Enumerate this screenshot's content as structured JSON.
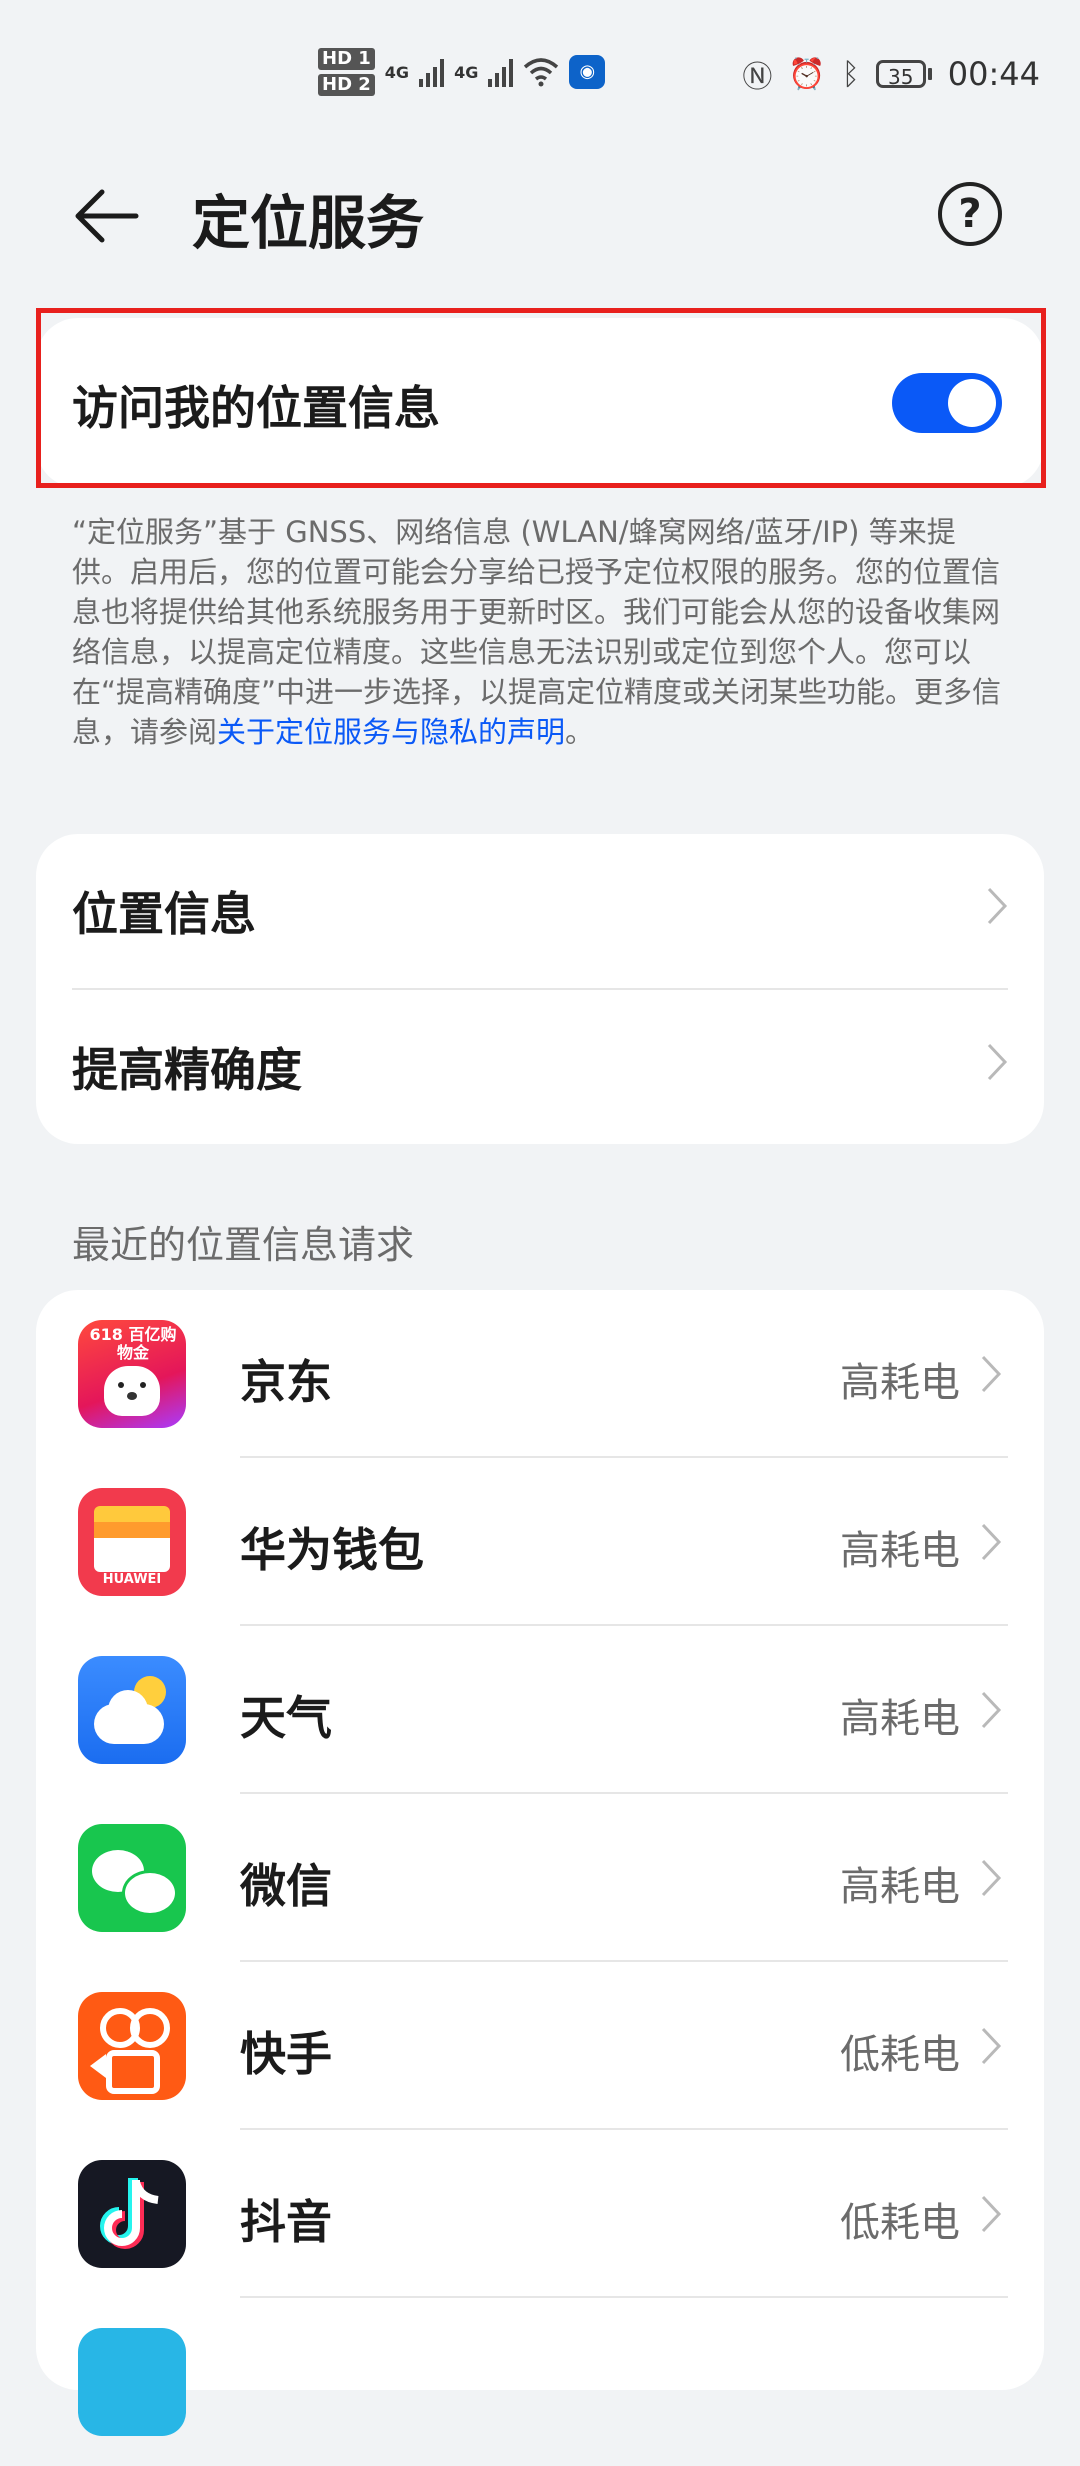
{
  "status_bar": {
    "hd1": "HD 1",
    "hd2": "HD 2",
    "net1": "4G",
    "net2": "4G",
    "battery": "35",
    "time": "00:44"
  },
  "header": {
    "title": "定位服务"
  },
  "location_toggle": {
    "label": "访问我的位置信息",
    "enabled": true,
    "accent_color": "#0a59f7"
  },
  "description": {
    "text": "“定位服务”基于 GNSS、网络信息 (WLAN/蜂窝网络/蓝牙/IP) 等来提供。启用后，您的位置可能会分享给已授予定位权限的服务。您的位置信息也将提供给其他系统服务用于更新时区。我们可能会从您的设备收集网络信息，以提高定位精度。这些信息无法识别或定位到您个人。您可以在“提高精确度”中进一步选择，以提高定位精度或关闭某些功能。更多信息，请参阅",
    "link": "关于定位服务与隐私的声明",
    "suffix": "。"
  },
  "settings": {
    "location_info": "位置信息",
    "improve_accuracy": "提高精确度"
  },
  "recent": {
    "title": "最近的位置信息请求",
    "apps": [
      {
        "name": "京东",
        "power": "高耗电",
        "icon": "jd-icon"
      },
      {
        "name": "华为钱包",
        "power": "高耗电",
        "icon": "huawei-wallet-icon"
      },
      {
        "name": "天气",
        "power": "高耗电",
        "icon": "weather-icon"
      },
      {
        "name": "微信",
        "power": "高耗电",
        "icon": "wechat-icon"
      },
      {
        "name": "快手",
        "power": "低耗电",
        "icon": "kuaishou-icon"
      },
      {
        "name": "抖音",
        "power": "低耗电",
        "icon": "douyin-icon"
      }
    ]
  },
  "jd_icon_text": "618 百亿购物金",
  "wallet_icon_text": "HUAWEI"
}
